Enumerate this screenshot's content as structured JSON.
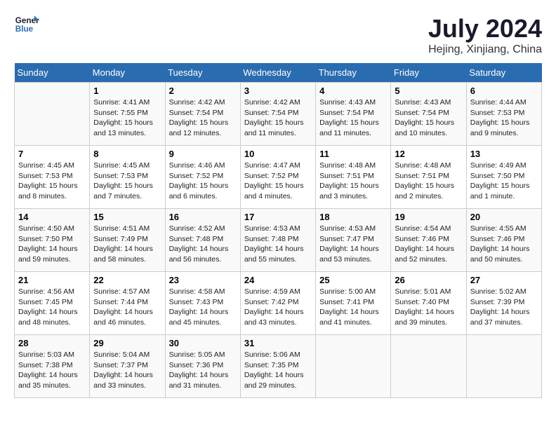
{
  "header": {
    "logo_text_general": "General",
    "logo_text_blue": "Blue",
    "month_year": "July 2024",
    "location": "Hejing, Xinjiang, China"
  },
  "days_of_week": [
    "Sunday",
    "Monday",
    "Tuesday",
    "Wednesday",
    "Thursday",
    "Friday",
    "Saturday"
  ],
  "weeks": [
    [
      {
        "day": "",
        "info": ""
      },
      {
        "day": "1",
        "info": "Sunrise: 4:41 AM\nSunset: 7:55 PM\nDaylight: 15 hours\nand 13 minutes."
      },
      {
        "day": "2",
        "info": "Sunrise: 4:42 AM\nSunset: 7:54 PM\nDaylight: 15 hours\nand 12 minutes."
      },
      {
        "day": "3",
        "info": "Sunrise: 4:42 AM\nSunset: 7:54 PM\nDaylight: 15 hours\nand 11 minutes."
      },
      {
        "day": "4",
        "info": "Sunrise: 4:43 AM\nSunset: 7:54 PM\nDaylight: 15 hours\nand 11 minutes."
      },
      {
        "day": "5",
        "info": "Sunrise: 4:43 AM\nSunset: 7:54 PM\nDaylight: 15 hours\nand 10 minutes."
      },
      {
        "day": "6",
        "info": "Sunrise: 4:44 AM\nSunset: 7:53 PM\nDaylight: 15 hours\nand 9 minutes."
      }
    ],
    [
      {
        "day": "7",
        "info": "Sunrise: 4:45 AM\nSunset: 7:53 PM\nDaylight: 15 hours\nand 8 minutes."
      },
      {
        "day": "8",
        "info": "Sunrise: 4:45 AM\nSunset: 7:53 PM\nDaylight: 15 hours\nand 7 minutes."
      },
      {
        "day": "9",
        "info": "Sunrise: 4:46 AM\nSunset: 7:52 PM\nDaylight: 15 hours\nand 6 minutes."
      },
      {
        "day": "10",
        "info": "Sunrise: 4:47 AM\nSunset: 7:52 PM\nDaylight: 15 hours\nand 4 minutes."
      },
      {
        "day": "11",
        "info": "Sunrise: 4:48 AM\nSunset: 7:51 PM\nDaylight: 15 hours\nand 3 minutes."
      },
      {
        "day": "12",
        "info": "Sunrise: 4:48 AM\nSunset: 7:51 PM\nDaylight: 15 hours\nand 2 minutes."
      },
      {
        "day": "13",
        "info": "Sunrise: 4:49 AM\nSunset: 7:50 PM\nDaylight: 15 hours\nand 1 minute."
      }
    ],
    [
      {
        "day": "14",
        "info": "Sunrise: 4:50 AM\nSunset: 7:50 PM\nDaylight: 14 hours\nand 59 minutes."
      },
      {
        "day": "15",
        "info": "Sunrise: 4:51 AM\nSunset: 7:49 PM\nDaylight: 14 hours\nand 58 minutes."
      },
      {
        "day": "16",
        "info": "Sunrise: 4:52 AM\nSunset: 7:48 PM\nDaylight: 14 hours\nand 56 minutes."
      },
      {
        "day": "17",
        "info": "Sunrise: 4:53 AM\nSunset: 7:48 PM\nDaylight: 14 hours\nand 55 minutes."
      },
      {
        "day": "18",
        "info": "Sunrise: 4:53 AM\nSunset: 7:47 PM\nDaylight: 14 hours\nand 53 minutes."
      },
      {
        "day": "19",
        "info": "Sunrise: 4:54 AM\nSunset: 7:46 PM\nDaylight: 14 hours\nand 52 minutes."
      },
      {
        "day": "20",
        "info": "Sunrise: 4:55 AM\nSunset: 7:46 PM\nDaylight: 14 hours\nand 50 minutes."
      }
    ],
    [
      {
        "day": "21",
        "info": "Sunrise: 4:56 AM\nSunset: 7:45 PM\nDaylight: 14 hours\nand 48 minutes."
      },
      {
        "day": "22",
        "info": "Sunrise: 4:57 AM\nSunset: 7:44 PM\nDaylight: 14 hours\nand 46 minutes."
      },
      {
        "day": "23",
        "info": "Sunrise: 4:58 AM\nSunset: 7:43 PM\nDaylight: 14 hours\nand 45 minutes."
      },
      {
        "day": "24",
        "info": "Sunrise: 4:59 AM\nSunset: 7:42 PM\nDaylight: 14 hours\nand 43 minutes."
      },
      {
        "day": "25",
        "info": "Sunrise: 5:00 AM\nSunset: 7:41 PM\nDaylight: 14 hours\nand 41 minutes."
      },
      {
        "day": "26",
        "info": "Sunrise: 5:01 AM\nSunset: 7:40 PM\nDaylight: 14 hours\nand 39 minutes."
      },
      {
        "day": "27",
        "info": "Sunrise: 5:02 AM\nSunset: 7:39 PM\nDaylight: 14 hours\nand 37 minutes."
      }
    ],
    [
      {
        "day": "28",
        "info": "Sunrise: 5:03 AM\nSunset: 7:38 PM\nDaylight: 14 hours\nand 35 minutes."
      },
      {
        "day": "29",
        "info": "Sunrise: 5:04 AM\nSunset: 7:37 PM\nDaylight: 14 hours\nand 33 minutes."
      },
      {
        "day": "30",
        "info": "Sunrise: 5:05 AM\nSunset: 7:36 PM\nDaylight: 14 hours\nand 31 minutes."
      },
      {
        "day": "31",
        "info": "Sunrise: 5:06 AM\nSunset: 7:35 PM\nDaylight: 14 hours\nand 29 minutes."
      },
      {
        "day": "",
        "info": ""
      },
      {
        "day": "",
        "info": ""
      },
      {
        "day": "",
        "info": ""
      }
    ]
  ]
}
